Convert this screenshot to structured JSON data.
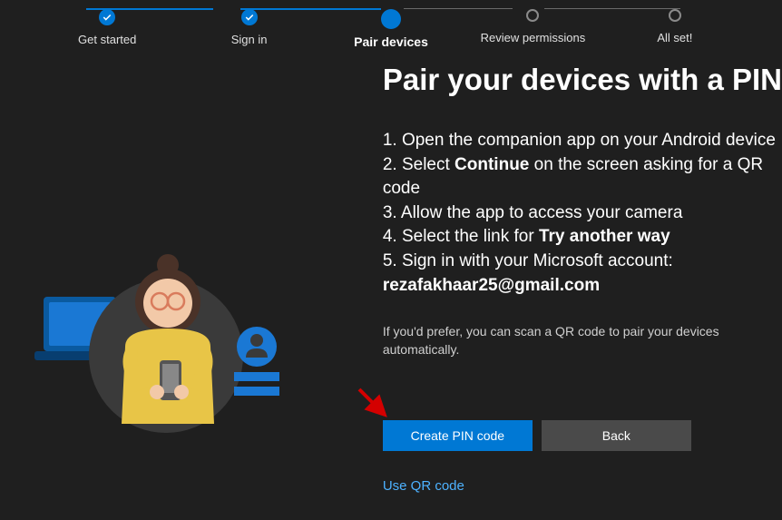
{
  "stepper": {
    "steps": [
      {
        "label": "Get started",
        "state": "done"
      },
      {
        "label": "Sign in",
        "state": "done"
      },
      {
        "label": "Pair devices",
        "state": "current"
      },
      {
        "label": "Review permissions",
        "state": "incomplete"
      },
      {
        "label": "All set!",
        "state": "incomplete"
      }
    ]
  },
  "page": {
    "title": "Pair your devices with a PIN"
  },
  "instructions": {
    "step1": "1. Open the companion app on your Android device",
    "step2_pre": "2. Select ",
    "step2_bold": "Continue",
    "step2_post": " on the screen asking for a QR code",
    "step3": "3. Allow the app to access your camera",
    "step4_pre": "4. Select the link for ",
    "step4_bold": "Try another way",
    "step5": "5. Sign in with your Microsoft account:",
    "email": "rezafakhaar25@gmail.com"
  },
  "secondary": "If you'd prefer, you can scan a QR code to pair your devices automatically.",
  "buttons": {
    "primary": "Create PIN code",
    "secondary": "Back"
  },
  "link": "Use QR code",
  "colors": {
    "accent": "#0078d4",
    "link": "#4db2ff"
  }
}
